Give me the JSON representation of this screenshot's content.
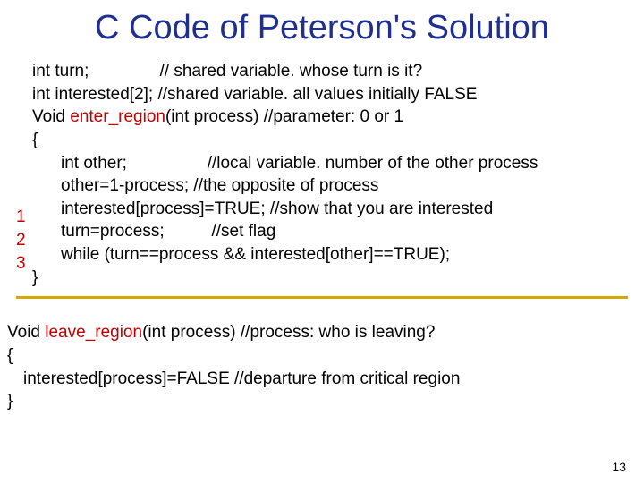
{
  "slide": {
    "title": "C Code of Peterson's Solution",
    "page_number": "13"
  },
  "enter_region": {
    "l1a": "int turn;",
    "l1b": "// shared variable. whose turn is it?",
    "l2": "int interested[2]; //shared variable. all values initially FALSE",
    "l3a": "Void ",
    "l3b": "enter_region",
    "l3c": "(int process) //parameter:  0 or 1",
    "l4": "{",
    "l5a": "int other;",
    "l5b": "//local variable. number of the other process",
    "l6": "other=1-process; //the opposite of process",
    "l7": "interested[process]=TRUE; //show that you are interested",
    "l8a": "turn=process;",
    "l8b": "//set flag",
    "l9": "while (turn==process && interested[other]==TRUE);",
    "l10": "}"
  },
  "line_numbers": {
    "n1": "1",
    "n2": "2",
    "n3": "3"
  },
  "leave_region": {
    "l1a": "Void ",
    "l1b": "leave_region",
    "l1c": "(int process) //process: who is leaving?",
    "l2": "{",
    "l3": "interested[process]=FALSE  //departure from critical region",
    "l4": "}"
  }
}
